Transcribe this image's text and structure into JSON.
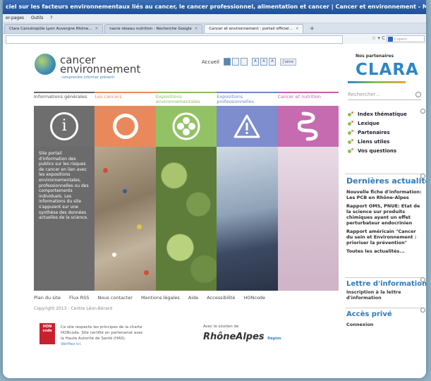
{
  "window": {
    "title": "ciel sur les facteurs environnementaux liés au cancer, le cancer professionnel, alimentation et cancer | Cancer et environnement - Mozilla Firefox"
  },
  "menubar": [
    "er-pages",
    "Outils",
    "?"
  ],
  "tabs": [
    {
      "label": "Clara Cancéropôle Lyon Auvergne Rhône..."
    },
    {
      "label": "nacre réseau nutrition - Recherche Google"
    },
    {
      "label": "Cancer et environnement : portail officiel..."
    }
  ],
  "browser": {
    "search_placeholder": "Copern"
  },
  "site": {
    "logo_line1": "cancer",
    "logo_line2": "environnement",
    "logo_tagline": "comprendre informer prévenir",
    "accueil": "Accueil",
    "like": "J'aime",
    "partners_title": "Nos partenaires",
    "clara": "CLARA",
    "search_placeholder": "Rechercher..."
  },
  "categories": [
    {
      "label": "Informations générales"
    },
    {
      "label": "Les cancers"
    },
    {
      "label": "Expositions environnementales"
    },
    {
      "label": "Expositions professionnelles"
    },
    {
      "label": "Cancer et nutrition"
    }
  ],
  "intro_text": "Site portail d'information des publics sur les risques de cancer en lien avec les expositions environnementales, professionnelles ou des comportements individuels. Les informations du site s'appuient sur une synthèse des données actuelles de la science.",
  "footer": {
    "links": [
      "Plan du site",
      "Flux RSS",
      "Nous contacter",
      "Mentions légales",
      "Aide",
      "Accessibilité",
      "HONcode"
    ],
    "copyright": "Copyright 2013 - Centre Léon-Bérard",
    "hon_logo": "HON code",
    "hon_text": "Ce site respecte les principes de la charte HONcode. Site certifié en partenariat avec la Haute Autorité de Santé (HAS).",
    "hon_link": "Vérifiez ici.",
    "support": "Avec le soutien de",
    "rhone1": "RhôneAlpes",
    "rhone_small": "Région"
  },
  "sidenav": [
    "Index thématique",
    "Lexique",
    "Partenaires",
    "Liens utiles",
    "Vos questions"
  ],
  "news": {
    "title": "Dernières actualités",
    "items": [
      "Nouvelle fiche d'information: Les PCB en Rhône-Alpes",
      "Rapport OMS, PNUE: Etat de la science sur produits chimiques ayant un effet perturbateur endocrinien",
      "Rapport américain \"Cancer du sein et Environnement : prioriser la prévention\"",
      "Toutes les actualités..."
    ]
  },
  "lettre": {
    "title": "Lettre d'information",
    "sub": "Inscription à la lettre d'information"
  },
  "acces": {
    "title": "Accès privé",
    "connexion": "Connexion"
  }
}
